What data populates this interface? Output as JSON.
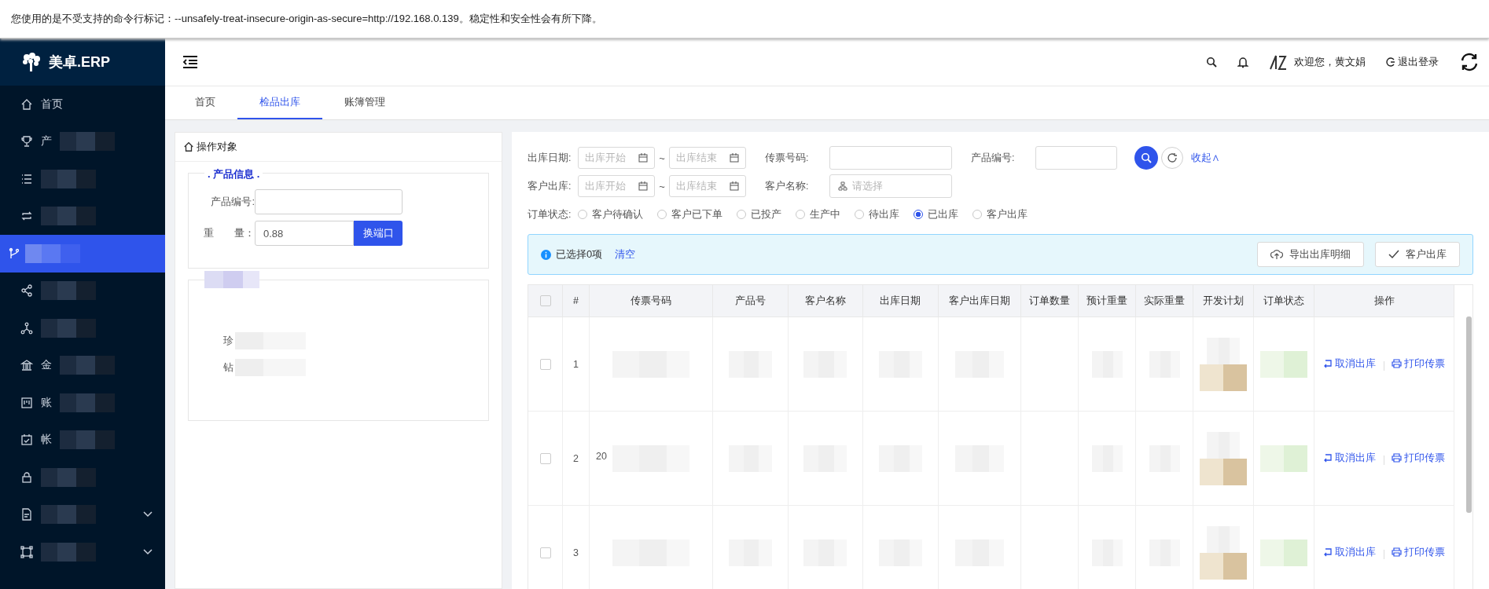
{
  "warning_bar": {
    "text": "您使用的是不受支持的命令行标记：--unsafely-treat-insecure-origin-as-secure=http://192.168.0.139。稳定性和安全性会有所下降。"
  },
  "logo": {
    "text": "美卓.ERP"
  },
  "sidebar": {
    "items": [
      {
        "label": "首页",
        "selected": false,
        "expandable": false
      },
      {
        "label": "产",
        "selected": false,
        "expandable": false
      },
      {
        "selected": false,
        "expandable": false
      },
      {
        "selected": false,
        "expandable": false
      },
      {
        "selected": true,
        "expandable": false
      },
      {
        "selected": false,
        "expandable": false
      },
      {
        "selected": false,
        "expandable": false
      },
      {
        "label": "金",
        "selected": false,
        "expandable": false
      },
      {
        "label": "账",
        "selected": false,
        "expandable": false
      },
      {
        "label": "帐",
        "selected": false,
        "expandable": false
      },
      {
        "selected": false,
        "expandable": false
      },
      {
        "selected": false,
        "expandable": true
      },
      {
        "selected": false,
        "expandable": true
      }
    ]
  },
  "header": {
    "greeting": "欢迎您，黄文娟",
    "logout": "退出登录"
  },
  "tabs": [
    {
      "label": "首页",
      "selected": false
    },
    {
      "label": "检品出库",
      "selected": true
    },
    {
      "label": "账簿管理",
      "selected": false
    }
  ],
  "left_panel": {
    "title": "操作对象",
    "legend": ". 产品信息 .",
    "product_label": "产品编号:",
    "weight_label": "重　　量：",
    "weight_value": "0.88",
    "port_button": "换端口",
    "partial_labels": [
      "珍",
      "钻"
    ]
  },
  "filters": {
    "ranges": [
      {
        "label": "出库日期:",
        "start_placeholder": "出库开始",
        "separator": "~",
        "end_placeholder": "出库结束"
      },
      {
        "label": "客户出库:",
        "start_placeholder": "出库开始",
        "separator": "~",
        "end_placeholder": "出库结束"
      }
    ],
    "ticket_label": "传票号码:",
    "product_label": "产品编号:",
    "customer_label": "客户名称:",
    "customer_placeholder": "请选择",
    "collapse": "收起∧",
    "status_label": "订单状态:",
    "statuses": [
      {
        "label": "客户待确认",
        "selected": false
      },
      {
        "label": "客户已下单",
        "selected": false
      },
      {
        "label": "已投产",
        "selected": false
      },
      {
        "label": "生产中",
        "selected": false
      },
      {
        "label": "待出库",
        "selected": false
      },
      {
        "label": "已出库",
        "selected": true
      },
      {
        "label": "客户出库",
        "selected": false
      }
    ]
  },
  "alert": {
    "text": "已选择0项",
    "clear": "清空",
    "export_button": "导出出库明细",
    "ship_button": "客户出库"
  },
  "table": {
    "select_all_checked": false,
    "columns": [
      "#",
      "传票号码",
      "产品号",
      "客户名称",
      "出库日期",
      "客户出库日期",
      "订单数量",
      "预计重量",
      "实际重量",
      "开发计划",
      "订单状态",
      "操作"
    ],
    "rows": [
      {
        "index": "1",
        "checked": false,
        "actions": [
          "取消出库",
          "打印传票"
        ]
      },
      {
        "index": "2",
        "checked": false,
        "ticket": "20",
        "actions": [
          "取消出库",
          "打印传票"
        ]
      },
      {
        "index": "3",
        "checked": false,
        "actions": [
          "取消出库",
          "打印传票"
        ]
      }
    ]
  }
}
